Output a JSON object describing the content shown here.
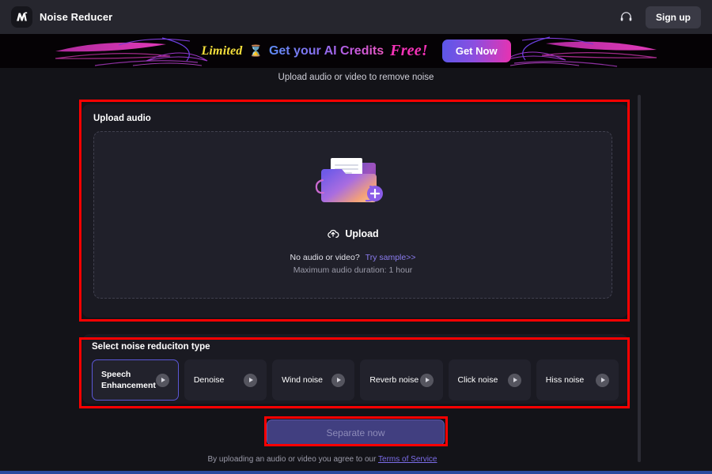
{
  "header": {
    "brand_title": "Noise Reducer",
    "logo_icon": "app-logo-m",
    "support_icon": "headset-icon",
    "signup_label": "Sign up"
  },
  "promo": {
    "limited_label": "Limited",
    "hourglass_icon": "hourglass-icon",
    "middle_text": "Get your AI Credits",
    "free_label": "Free!",
    "cta_label": "Get Now",
    "accent_yellow": "#f5e03c",
    "accent_pink": "#f533b8"
  },
  "page": {
    "subtitle": "Upload audio or video to remove noise"
  },
  "upload": {
    "panel_title": "Upload audio",
    "folder_icon": "upload-folder-illustration",
    "upload_icon": "cloud-upload-icon",
    "upload_label": "Upload",
    "no_media_question": "No audio or video?",
    "try_sample_label": "Try sample>>",
    "max_duration_note": "Maximum audio duration: 1 hour"
  },
  "noise_types": {
    "section_title": "Select noise reduciton type",
    "selected_index": 0,
    "play_icon": "play-icon",
    "cards": [
      {
        "label": "Speech Enhancement"
      },
      {
        "label": "Denoise"
      },
      {
        "label": "Wind noise"
      },
      {
        "label": "Reverb noise"
      },
      {
        "label": "Click noise"
      },
      {
        "label": "Hiss noise"
      }
    ]
  },
  "action": {
    "separate_label": "Separate now",
    "disabled": true
  },
  "footer": {
    "agreement_text": "By uploading an audio or video you agree to our",
    "tos_label": "Terms of Service"
  },
  "annotations": {
    "color": "#ff0000",
    "boxes": [
      "upload-panel",
      "noise-type-panel",
      "separate-button"
    ]
  }
}
